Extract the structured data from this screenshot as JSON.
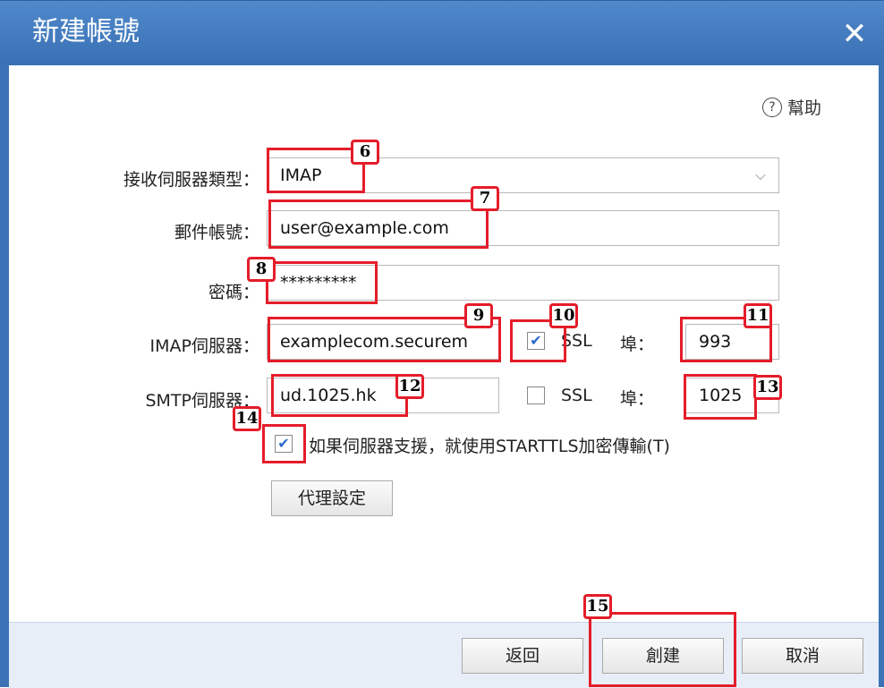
{
  "window": {
    "title": "新建帳號",
    "close_icon": "close-icon"
  },
  "help": {
    "icon": "help-circle-icon",
    "label": "幫助"
  },
  "form": {
    "server_type": {
      "label": "接收伺服器類型：",
      "value": "IMAP"
    },
    "email": {
      "label": "郵件帳號：",
      "value": "user@example.com"
    },
    "password": {
      "label": "密碼：",
      "value": "*********"
    },
    "imap": {
      "label": "IMAP伺服器：",
      "value": "examplecom.securem",
      "ssl_checked": true,
      "ssl_label": "SSL",
      "port_label": "埠：",
      "port": "993"
    },
    "smtp": {
      "label": "SMTP伺服器：",
      "value": "ud.1025.hk",
      "ssl_checked": false,
      "ssl_label": "SSL",
      "port_label": "埠：",
      "port": "1025"
    },
    "starttls": {
      "checked": true,
      "label": "如果伺服器支援，就使用STARTTLS加密傳輸(T)"
    },
    "proxy_button": "代理設定"
  },
  "footer": {
    "back_button": "返回",
    "create_button": "創建",
    "cancel_button": "取消"
  },
  "annotations": {
    "a6": "6",
    "a7": "7",
    "a8": "8",
    "a9": "9",
    "a10": "10",
    "a11": "11",
    "a12": "12",
    "a13": "13",
    "a14": "14",
    "a15": "15"
  },
  "colors": {
    "titlebar": "#3f78bf",
    "annotation": "#e41d2a",
    "check": "#2a6ac7"
  }
}
